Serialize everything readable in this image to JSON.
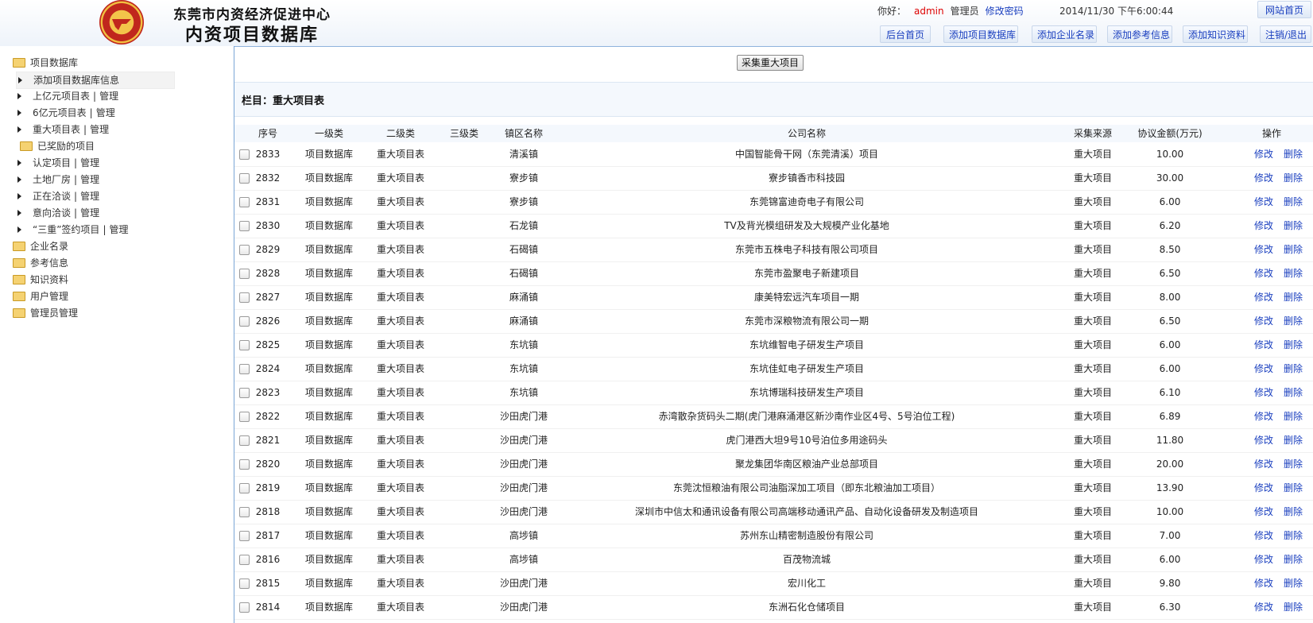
{
  "header": {
    "org_name": "东莞市内资经济促进中心",
    "db_title": "内资项目数据库",
    "greeting": "你好：",
    "username": "admin",
    "role": "管理员",
    "change_password": "修改密码",
    "datetime": "2014/11/30 下午6:00:44",
    "site_home": "网站首页",
    "nav": [
      "后台首页",
      "添加项目数据库",
      "添加企业名录",
      "添加参考信息",
      "添加知识资料",
      "注销/退出"
    ]
  },
  "sidebar": {
    "root": "项目数据库",
    "items": [
      {
        "label": "添加项目数据库信息",
        "manage": ""
      },
      {
        "label": "上亿元项目表",
        "manage": "管理"
      },
      {
        "label": "6亿元项目表",
        "manage": "管理"
      },
      {
        "label": "重大项目表",
        "manage": "管理"
      }
    ],
    "awarded": "已奖励的项目",
    "awarded_items": [
      {
        "label": "认定项目",
        "manage": "管理"
      },
      {
        "label": "土地厂房",
        "manage": "管理"
      },
      {
        "label": "正在洽谈",
        "manage": "管理"
      },
      {
        "label": "意向洽谈",
        "manage": "管理"
      },
      {
        "label": "“三重”签约项目",
        "manage": "管理"
      }
    ],
    "folders": [
      "企业名录",
      "参考信息",
      "知识资料",
      "用户管理",
      "管理员管理"
    ]
  },
  "main": {
    "collect_button": "采集重大项目",
    "column_title": "栏目：重大项目表",
    "headers": [
      "序号",
      "一级类",
      "二级类",
      "三级类",
      "镇区名称",
      "公司名称",
      "采集来源",
      "协议金额(万元)",
      "操作"
    ],
    "edit_label": "修改",
    "delete_label": "删除",
    "rows": [
      {
        "id": "2833",
        "cat1": "项目数据库",
        "cat2": "重大项目表",
        "cat3": "",
        "town": "清溪镇",
        "company": "中国智能骨干网（东莞清溪）项目",
        "source": "重大项目",
        "amount": "10.00"
      },
      {
        "id": "2832",
        "cat1": "项目数据库",
        "cat2": "重大项目表",
        "cat3": "",
        "town": "寮步镇",
        "company": "寮步镇香市科技园",
        "source": "重大项目",
        "amount": "30.00"
      },
      {
        "id": "2831",
        "cat1": "项目数据库",
        "cat2": "重大项目表",
        "cat3": "",
        "town": "寮步镇",
        "company": "东莞锦富迪奇电子有限公司",
        "source": "重大项目",
        "amount": "6.00"
      },
      {
        "id": "2830",
        "cat1": "项目数据库",
        "cat2": "重大项目表",
        "cat3": "",
        "town": "石龙镇",
        "company": "TV及背光模组研发及大规模产业化基地",
        "source": "重大项目",
        "amount": "6.20"
      },
      {
        "id": "2829",
        "cat1": "项目数据库",
        "cat2": "重大项目表",
        "cat3": "",
        "town": "石碣镇",
        "company": "东莞市五株电子科技有限公司项目",
        "source": "重大项目",
        "amount": "8.50"
      },
      {
        "id": "2828",
        "cat1": "项目数据库",
        "cat2": "重大项目表",
        "cat3": "",
        "town": "石碣镇",
        "company": "东莞市盈聚电子新建项目",
        "source": "重大项目",
        "amount": "6.50"
      },
      {
        "id": "2827",
        "cat1": "项目数据库",
        "cat2": "重大项目表",
        "cat3": "",
        "town": "麻涌镇",
        "company": "康美特宏远汽车项目一期",
        "source": "重大项目",
        "amount": "8.00"
      },
      {
        "id": "2826",
        "cat1": "项目数据库",
        "cat2": "重大项目表",
        "cat3": "",
        "town": "麻涌镇",
        "company": "东莞市深粮物流有限公司一期",
        "source": "重大项目",
        "amount": "6.50"
      },
      {
        "id": "2825",
        "cat1": "项目数据库",
        "cat2": "重大项目表",
        "cat3": "",
        "town": "东坑镇",
        "company": "东坑维智电子研发生产项目",
        "source": "重大项目",
        "amount": "6.00"
      },
      {
        "id": "2824",
        "cat1": "项目数据库",
        "cat2": "重大项目表",
        "cat3": "",
        "town": "东坑镇",
        "company": "东坑佳虹电子研发生产项目",
        "source": "重大项目",
        "amount": "6.00"
      },
      {
        "id": "2823",
        "cat1": "项目数据库",
        "cat2": "重大项目表",
        "cat3": "",
        "town": "东坑镇",
        "company": "东坑博瑞科技研发生产项目",
        "source": "重大项目",
        "amount": "6.10"
      },
      {
        "id": "2822",
        "cat1": "项目数据库",
        "cat2": "重大项目表",
        "cat3": "",
        "town": "沙田虎门港",
        "company": "赤湾散杂货码头二期(虎门港麻涌港区新沙南作业区4号、5号泊位工程)",
        "source": "重大项目",
        "amount": "6.89"
      },
      {
        "id": "2821",
        "cat1": "项目数据库",
        "cat2": "重大项目表",
        "cat3": "",
        "town": "沙田虎门港",
        "company": "虎门港西大坦9号10号泊位多用途码头",
        "source": "重大项目",
        "amount": "11.80"
      },
      {
        "id": "2820",
        "cat1": "项目数据库",
        "cat2": "重大项目表",
        "cat3": "",
        "town": "沙田虎门港",
        "company": "聚龙集团华南区粮油产业总部项目",
        "source": "重大项目",
        "amount": "20.00"
      },
      {
        "id": "2819",
        "cat1": "项目数据库",
        "cat2": "重大项目表",
        "cat3": "",
        "town": "沙田虎门港",
        "company": "东莞沈恒粮油有限公司油脂深加工项目（即东北粮油加工项目）",
        "source": "重大项目",
        "amount": "13.90"
      },
      {
        "id": "2818",
        "cat1": "项目数据库",
        "cat2": "重大项目表",
        "cat3": "",
        "town": "沙田虎门港",
        "company": "深圳市中信太和通讯设备有限公司高端移动通讯产品、自动化设备研发及制造项目",
        "source": "重大项目",
        "amount": "10.00"
      },
      {
        "id": "2817",
        "cat1": "项目数据库",
        "cat2": "重大项目表",
        "cat3": "",
        "town": "高埗镇",
        "company": "苏州东山精密制造股份有限公司",
        "source": "重大项目",
        "amount": "7.00"
      },
      {
        "id": "2816",
        "cat1": "项目数据库",
        "cat2": "重大项目表",
        "cat3": "",
        "town": "高埗镇",
        "company": "百茂物流城",
        "source": "重大项目",
        "amount": "6.00"
      },
      {
        "id": "2815",
        "cat1": "项目数据库",
        "cat2": "重大项目表",
        "cat3": "",
        "town": "沙田虎门港",
        "company": "宏川化工",
        "source": "重大项目",
        "amount": "9.80"
      },
      {
        "id": "2814",
        "cat1": "项目数据库",
        "cat2": "重大项目表",
        "cat3": "",
        "town": "沙田虎门港",
        "company": "东洲石化仓储项目",
        "source": "重大项目",
        "amount": "6.30"
      }
    ]
  }
}
